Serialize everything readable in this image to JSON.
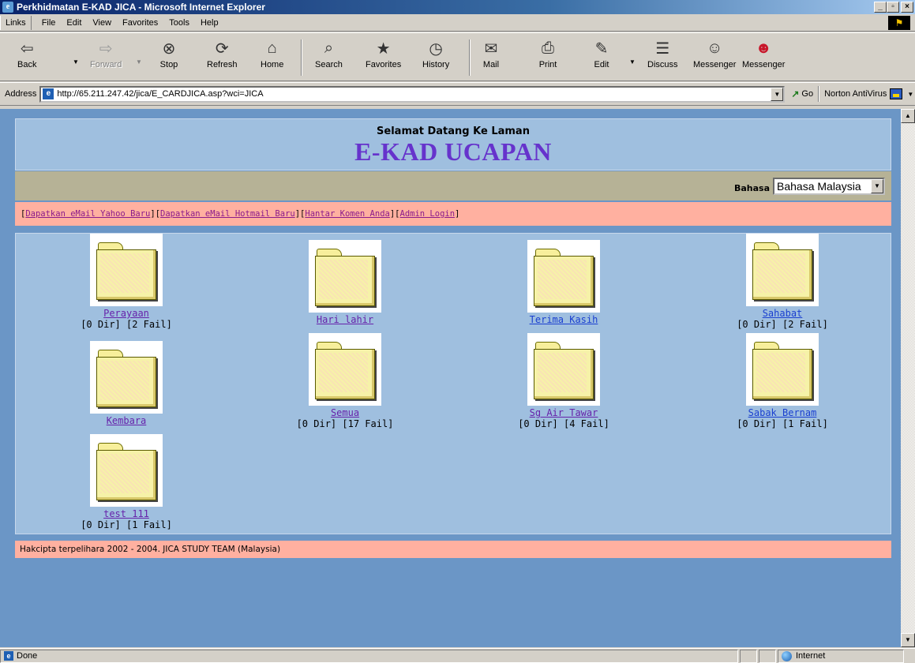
{
  "window": {
    "title": "Perkhidmatan E-KAD JICA - Microsoft Internet Explorer",
    "minimize": "_",
    "maximize": "▫",
    "close": "×"
  },
  "menu": {
    "links": "Links",
    "items": [
      "File",
      "Edit",
      "View",
      "Favorites",
      "Tools",
      "Help"
    ]
  },
  "toolbar": {
    "buttons": [
      {
        "label": "Back",
        "icon": "back-arrow-icon"
      },
      {
        "label": "Forward",
        "icon": "forward-arrow-icon"
      },
      {
        "label": "Stop",
        "icon": "stop-icon"
      },
      {
        "label": "Refresh",
        "icon": "refresh-icon"
      },
      {
        "label": "Home",
        "icon": "home-icon"
      },
      {
        "label": "Search",
        "icon": "search-icon"
      },
      {
        "label": "Favorites",
        "icon": "favorites-icon"
      },
      {
        "label": "History",
        "icon": "history-icon"
      },
      {
        "label": "Mail",
        "icon": "mail-icon"
      },
      {
        "label": "Print",
        "icon": "print-icon"
      },
      {
        "label": "Edit",
        "icon": "edit-icon"
      },
      {
        "label": "Discuss",
        "icon": "discuss-icon"
      },
      {
        "label": "Messenger",
        "icon": "messenger-icon"
      },
      {
        "label": "Messenger",
        "icon": "messenger-award-icon"
      }
    ]
  },
  "address": {
    "label": "Address",
    "url": "http://65.211.247.42/jica/E_CARDJICA.asp?wci=JICA",
    "go": "Go",
    "norton": "Norton AntiVirus"
  },
  "page": {
    "welcome_sub": "Selamat Datang Ke Laman",
    "welcome_title": "E-KAD UCAPAN",
    "language_label": "Bahasa",
    "language_value": "Bahasa Malaysia",
    "links": [
      "Dapatkan eMail Yahoo Baru",
      "Dapatkan eMail Hotmail Baru",
      "Hantar Komen Anda",
      "Admin Login"
    ],
    "folders": [
      {
        "name": "Perayaan",
        "meta": "[0 Dir] [2 Fail]"
      },
      {
        "name": "Hari lahir",
        "meta": ""
      },
      {
        "name": "Terima Kasih",
        "meta": ""
      },
      {
        "name": "Sahabat",
        "meta": "[0 Dir] [2 Fail]"
      },
      {
        "name": "Kembara",
        "meta": ""
      },
      {
        "name": "Semua",
        "meta": "[0 Dir] [17 Fail]"
      },
      {
        "name": "Sg Air Tawar",
        "meta": "[0 Dir] [4 Fail]"
      },
      {
        "name": "Sabak Bernam",
        "meta": "[0 Dir] [1 Fail]"
      },
      {
        "name": "test 111",
        "meta": "[0 Dir] [1 Fail]"
      }
    ],
    "footer": "Hakcipta terpelihara 2002 - 2004. JICA STUDY TEAM (Malaysia)"
  },
  "status": {
    "text": "Done",
    "zone": "Internet"
  }
}
